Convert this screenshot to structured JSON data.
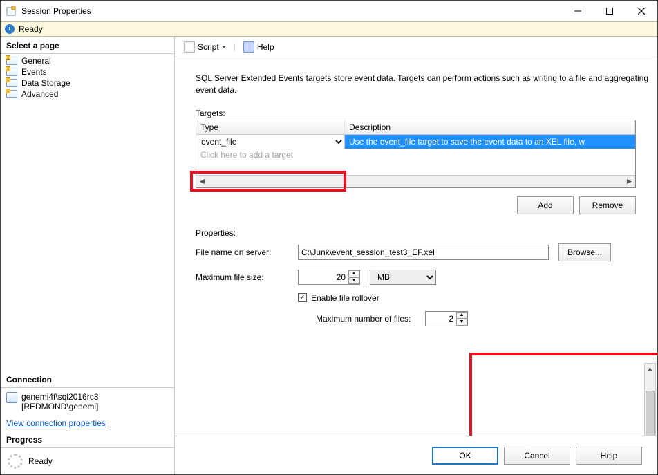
{
  "window": {
    "title": "Session Properties"
  },
  "status": {
    "text": "Ready"
  },
  "sidebar": {
    "select_a_page": "Select a page",
    "items": [
      "General",
      "Events",
      "Data Storage",
      "Advanced"
    ],
    "selected_index": 2,
    "connection_header": "Connection",
    "connection_server": "genemi4f\\sql2016rc3",
    "connection_user": "[REDMOND\\genemi]",
    "view_connection": "View connection properties",
    "progress_header": "Progress",
    "progress_text": "Ready"
  },
  "toolbar": {
    "script": "Script",
    "help": "Help"
  },
  "main": {
    "description": "SQL Server Extended Events targets store event data. Targets can perform actions such as writing to a file and aggregating event data.",
    "targets_label": "Targets:",
    "col_type": "Type",
    "col_description": "Description",
    "target_type_value": "event_file",
    "target_desc_value": "Use the event_file target to save the event data to an XEL file, w",
    "add_target_placeholder": "Click here to add a target",
    "add_label": "Add",
    "remove_label": "Remove",
    "properties_label": "Properties:",
    "file_label": "File name on server:",
    "file_value": "C:\\Junk\\event_session_test3_EF.xel",
    "browse_label": "Browse...",
    "maxsize_label": "Maximum file size:",
    "maxsize_value": "20",
    "maxsize_unit": "MB",
    "rollover_label": "Enable file rollover",
    "rollover_checked": true,
    "maxfiles_label": "Maximum number of files:",
    "maxfiles_value": "2"
  },
  "footer": {
    "ok": "OK",
    "cancel": "Cancel",
    "help": "Help"
  }
}
